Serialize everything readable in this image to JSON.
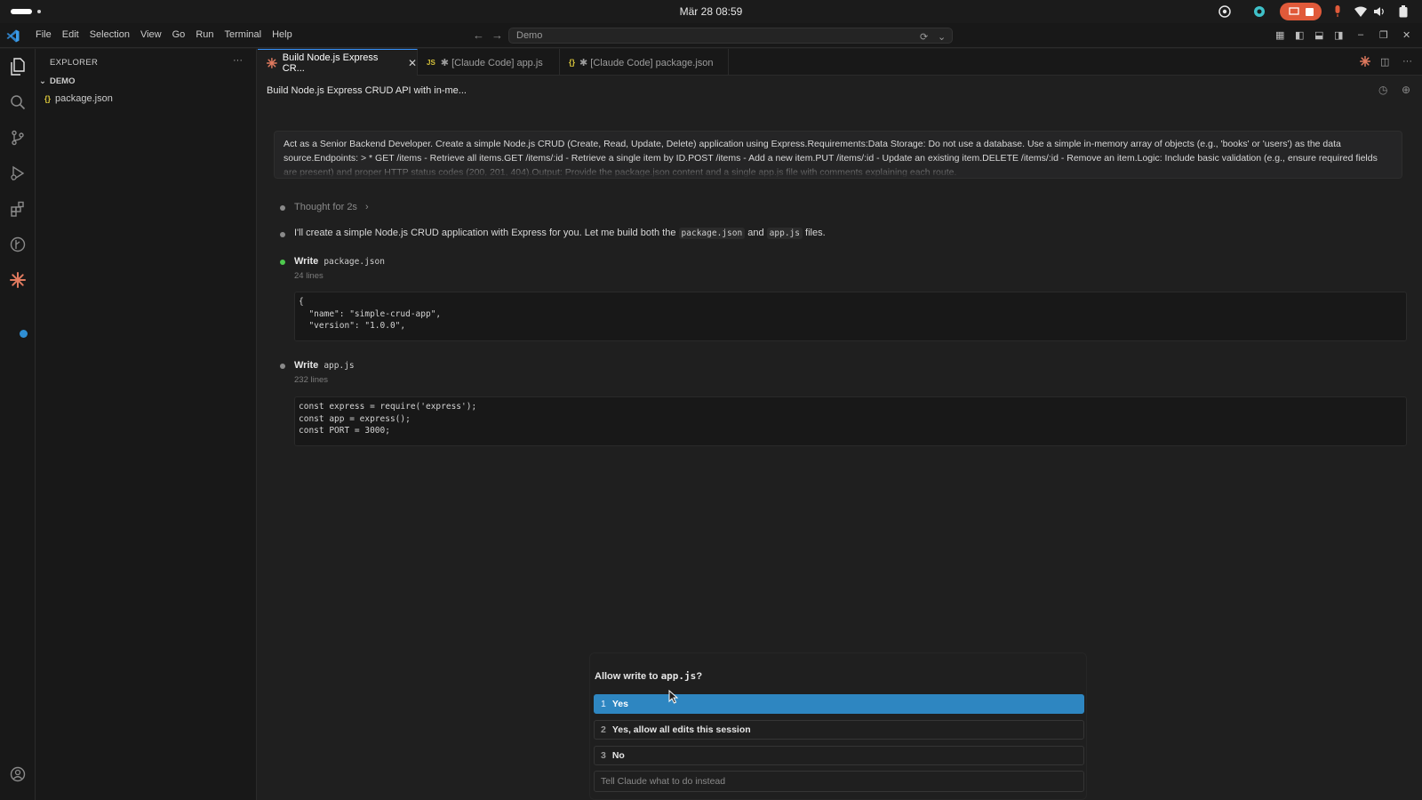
{
  "os": {
    "clock": "Mär 28  08:59"
  },
  "menu": [
    "File",
    "Edit",
    "Selection",
    "View",
    "Go",
    "Run",
    "Terminal",
    "Help"
  ],
  "command_center": {
    "text": "Demo"
  },
  "explorer": {
    "title": "EXPLORER",
    "more": "···",
    "folder": "DEMO",
    "file_icon": "{}",
    "file": "package.json"
  },
  "tabs": [
    {
      "label": "Build Node.js Express CR...",
      "icon": "claude-spark-icon",
      "active": true,
      "close": "✕"
    },
    {
      "label": "✱ [Claude Code] app.js",
      "icon_text": "JS",
      "active": false
    },
    {
      "label": "✱ [Claude Code] package.json",
      "icon_text": "{}",
      "active": false
    }
  ],
  "conversation": {
    "title": "Build Node.js Express CRUD API with in-me...",
    "prompt": "Act as a Senior Backend Developer. Create a simple Node.js CRUD (Create, Read, Update, Delete) application using Express.Requirements:Data Storage: Do not use a database. Use a simple in-memory array of objects (e.g., 'books' or 'users') as the data source.Endpoints: >    * GET /items - Retrieve all items.GET /items/:id - Retrieve a single item by ID.POST /items - Add a new item.PUT /items/:id - Update an existing item.DELETE /items/:id - Remove an item.Logic: Include basic validation (e.g., ensure required fields are present) and proper HTTP status codes (200, 201, 404).Output: Provide the package.json content and a single app.js file with comments explaining each route.",
    "thought": "Thought for 2s",
    "thought_chevron": "›",
    "reply_prefix": "I'll create a simple Node.js CRUD application with Express for you. Let me build both the",
    "reply_code1": "package.json",
    "reply_and": "and",
    "reply_code2": "app.js",
    "reply_suffix": "files.",
    "write1": {
      "label": "Write",
      "file": "package.json",
      "lines": "24 lines",
      "code": "{\n  \"name\": \"simple-crud-app\",\n  \"version\": \"1.0.0\","
    },
    "write2": {
      "label": "Write",
      "file": "app.js",
      "lines": "232 lines",
      "code": "const express = require('express');\nconst app = express();\nconst PORT = 3000;"
    }
  },
  "permission": {
    "question_prefix": "Allow write to",
    "question_file": "app.js",
    "question_suffix": "?",
    "options": [
      {
        "num": "1",
        "label": "Yes"
      },
      {
        "num": "2",
        "label": "Yes, allow all edits this session"
      },
      {
        "num": "3",
        "label": "No"
      }
    ],
    "input_placeholder": "Tell Claude what to do instead"
  },
  "colors": {
    "accent": "#2e86c1",
    "claude": "#e07a5f",
    "record": "#e05a3a",
    "status_green": "#4ec94e"
  }
}
